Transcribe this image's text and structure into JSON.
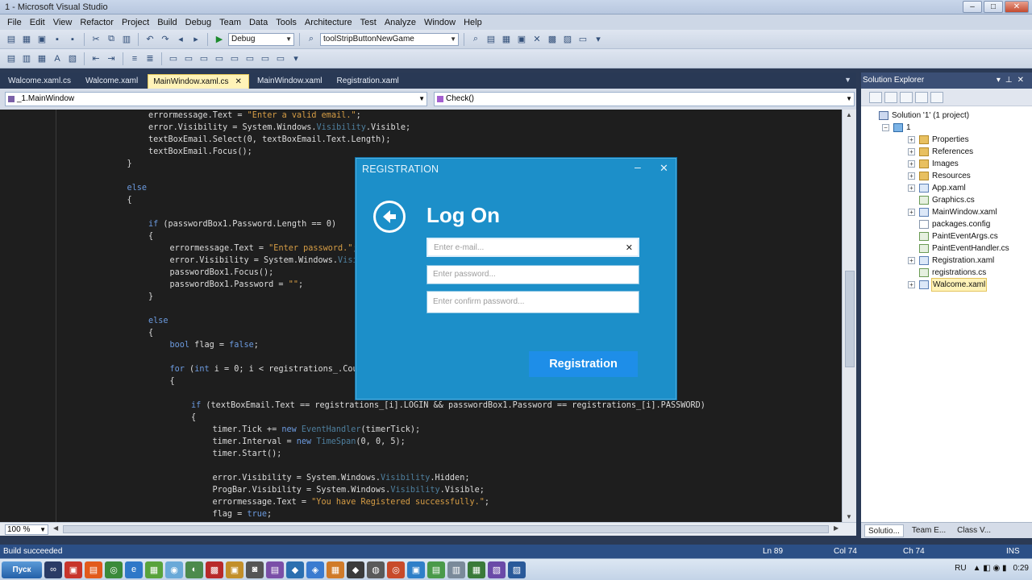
{
  "window": {
    "title": "1 - Microsoft Visual Studio"
  },
  "menu": [
    "File",
    "Edit",
    "View",
    "Refactor",
    "Project",
    "Build",
    "Debug",
    "Team",
    "Data",
    "Tools",
    "Architecture",
    "Test",
    "Analyze",
    "Window",
    "Help"
  ],
  "toolbar": {
    "config": "Debug",
    "find": "toolStripButtonNewGame"
  },
  "tabs": [
    "Walcome.xaml.cs",
    "Walcome.xaml",
    "MainWindow.xaml.cs",
    "MainWindow.xaml",
    "Registration.xaml"
  ],
  "active_tab_index": 2,
  "navbar": {
    "class": "_1.MainWindow",
    "member": "Check()"
  },
  "code": [
    {
      "i": 4,
      "t": [
        [
          "errormessage.Text = ",
          ""
        ],
        [
          "\"Enter a valid email.\"",
          "st"
        ],
        [
          ";",
          ""
        ]
      ]
    },
    {
      "i": 4,
      "t": [
        [
          "error.Visibility = System.Windows.",
          ""
        ],
        [
          "Visibility",
          "ty"
        ],
        [
          ".Visible;",
          ""
        ]
      ]
    },
    {
      "i": 4,
      "t": [
        [
          "textBoxEmail.Select(0, textBoxEmail.Text.Length);",
          ""
        ]
      ]
    },
    {
      "i": 4,
      "t": [
        [
          "textBoxEmail.Focus();",
          ""
        ]
      ]
    },
    {
      "i": 3,
      "t": [
        [
          "}",
          ""
        ]
      ]
    },
    {
      "i": 0,
      "t": []
    },
    {
      "i": 3,
      "t": [
        [
          "else",
          "kw"
        ]
      ]
    },
    {
      "i": 3,
      "t": [
        [
          "{",
          ""
        ]
      ]
    },
    {
      "i": 0,
      "t": []
    },
    {
      "i": 4,
      "t": [
        [
          "if",
          "kw"
        ],
        [
          " (passwordBox1.Password.Length == 0)",
          ""
        ]
      ]
    },
    {
      "i": 4,
      "t": [
        [
          "{",
          ""
        ]
      ]
    },
    {
      "i": 5,
      "t": [
        [
          "errormessage.Text = ",
          ""
        ],
        [
          "\"Enter password.\"",
          "st"
        ],
        [
          ";",
          ""
        ]
      ]
    },
    {
      "i": 5,
      "t": [
        [
          "error.Visibility = System.Windows.",
          ""
        ],
        [
          "Visibility",
          "ty"
        ],
        [
          ".Visible;",
          ""
        ]
      ]
    },
    {
      "i": 5,
      "t": [
        [
          "passwordBox1.Focus();",
          ""
        ]
      ]
    },
    {
      "i": 5,
      "t": [
        [
          "passwordBox1.Password = ",
          ""
        ],
        [
          "\"\"",
          "st"
        ],
        [
          ";",
          ""
        ]
      ]
    },
    {
      "i": 4,
      "t": [
        [
          "}",
          ""
        ]
      ]
    },
    {
      "i": 0,
      "t": []
    },
    {
      "i": 4,
      "t": [
        [
          "else",
          "kw"
        ]
      ]
    },
    {
      "i": 4,
      "t": [
        [
          "{",
          ""
        ]
      ]
    },
    {
      "i": 5,
      "t": [
        [
          "bool",
          "kw"
        ],
        [
          " flag = ",
          ""
        ],
        [
          "false",
          "kw"
        ],
        [
          ";",
          ""
        ]
      ]
    },
    {
      "i": 0,
      "t": []
    },
    {
      "i": 5,
      "t": [
        [
          "for",
          "kw"
        ],
        [
          " (",
          ""
        ],
        [
          "int",
          "kw"
        ],
        [
          " i = 0; i < registrations_.Count; i++)",
          ""
        ]
      ]
    },
    {
      "i": 5,
      "t": [
        [
          "{",
          ""
        ]
      ]
    },
    {
      "i": 0,
      "t": []
    },
    {
      "i": 6,
      "t": [
        [
          "if",
          "kw"
        ],
        [
          " (textBoxEmail.Text == registrations_[i].LOGIN && passwordBox1.Password == registrations_[i].PASSWORD)",
          ""
        ]
      ]
    },
    {
      "i": 6,
      "t": [
        [
          "{",
          ""
        ]
      ]
    },
    {
      "i": 7,
      "t": [
        [
          "timer.Tick += ",
          ""
        ],
        [
          "new",
          "kw"
        ],
        [
          " ",
          ""
        ],
        [
          "EventHandler",
          "ty"
        ],
        [
          "(timerTick);",
          ""
        ]
      ]
    },
    {
      "i": 7,
      "t": [
        [
          "timer.Interval = ",
          ""
        ],
        [
          "new",
          "kw"
        ],
        [
          " ",
          ""
        ],
        [
          "TimeSpan",
          "ty"
        ],
        [
          "(0, 0, 5);",
          ""
        ]
      ]
    },
    {
      "i": 7,
      "t": [
        [
          "timer.Start();",
          ""
        ]
      ]
    },
    {
      "i": 0,
      "t": []
    },
    {
      "i": 7,
      "t": [
        [
          "error.Visibility = System.Windows.",
          ""
        ],
        [
          "Visibility",
          "ty"
        ],
        [
          ".Hidden;",
          ""
        ]
      ]
    },
    {
      "i": 7,
      "t": [
        [
          "ProgBar.Visibility = System.Windows.",
          ""
        ],
        [
          "Visibility",
          "ty"
        ],
        [
          ".Visible;",
          ""
        ]
      ]
    },
    {
      "i": 7,
      "t": [
        [
          "errormessage.Text = ",
          ""
        ],
        [
          "\"You have Registered successfully.\"",
          "st"
        ],
        [
          ";",
          ""
        ]
      ]
    },
    {
      "i": 7,
      "t": [
        [
          "flag = ",
          ""
        ],
        [
          "true",
          "kw"
        ],
        [
          ";",
          ""
        ]
      ]
    }
  ],
  "zoom": "100 %",
  "solution_explorer": {
    "title": "Solution Explorer",
    "nodes": [
      {
        "label": "Solution '1' (1 project)",
        "depth": 0,
        "exp": "",
        "icon": "sol"
      },
      {
        "label": "1",
        "depth": 1,
        "exp": "−",
        "icon": "proj"
      },
      {
        "label": "Properties",
        "depth": 2,
        "exp": "+",
        "icon": "folder"
      },
      {
        "label": "References",
        "depth": 2,
        "exp": "+",
        "icon": "folder"
      },
      {
        "label": "Images",
        "depth": 2,
        "exp": "+",
        "icon": "folder"
      },
      {
        "label": "Resources",
        "depth": 2,
        "exp": "+",
        "icon": "folder"
      },
      {
        "label": "App.xaml",
        "depth": 2,
        "exp": "+",
        "icon": "xaml"
      },
      {
        "label": "Graphics.cs",
        "depth": 2,
        "exp": "",
        "icon": "cs"
      },
      {
        "label": "MainWindow.xaml",
        "depth": 2,
        "exp": "+",
        "icon": "xaml"
      },
      {
        "label": "packages.config",
        "depth": 2,
        "exp": "",
        "icon": "file"
      },
      {
        "label": "PaintEventArgs.cs",
        "depth": 2,
        "exp": "",
        "icon": "cs"
      },
      {
        "label": "PaintEventHandler.cs",
        "depth": 2,
        "exp": "",
        "icon": "cs"
      },
      {
        "label": "Registration.xaml",
        "depth": 2,
        "exp": "+",
        "icon": "xaml"
      },
      {
        "label": "registrations.cs",
        "depth": 2,
        "exp": "",
        "icon": "cs"
      },
      {
        "label": "Walcome.xaml",
        "depth": 2,
        "exp": "+",
        "icon": "xaml",
        "selected": true
      }
    ],
    "bottom_tabs": [
      "Solutio...",
      "Team E...",
      "Class V..."
    ]
  },
  "status": {
    "message": "Build succeeded",
    "ln": "Ln 89",
    "col": "Col 74",
    "ch": "Ch 74",
    "mode": "INS"
  },
  "taskbar": {
    "start": "Пуск",
    "lang": "RU",
    "time": "0:29"
  },
  "dialog": {
    "title": "REGISTRATION",
    "heading": "Log On",
    "email_placeholder": "Enter e-mail...",
    "password_placeholder": "Enter password...",
    "confirm_placeholder": "Enter confirm password...",
    "button": "Registration"
  },
  "colors": {
    "dialog_bg": "#1c8fc9",
    "button_bg": "#1e8ee8",
    "editor_bg": "#1e1e1e"
  }
}
